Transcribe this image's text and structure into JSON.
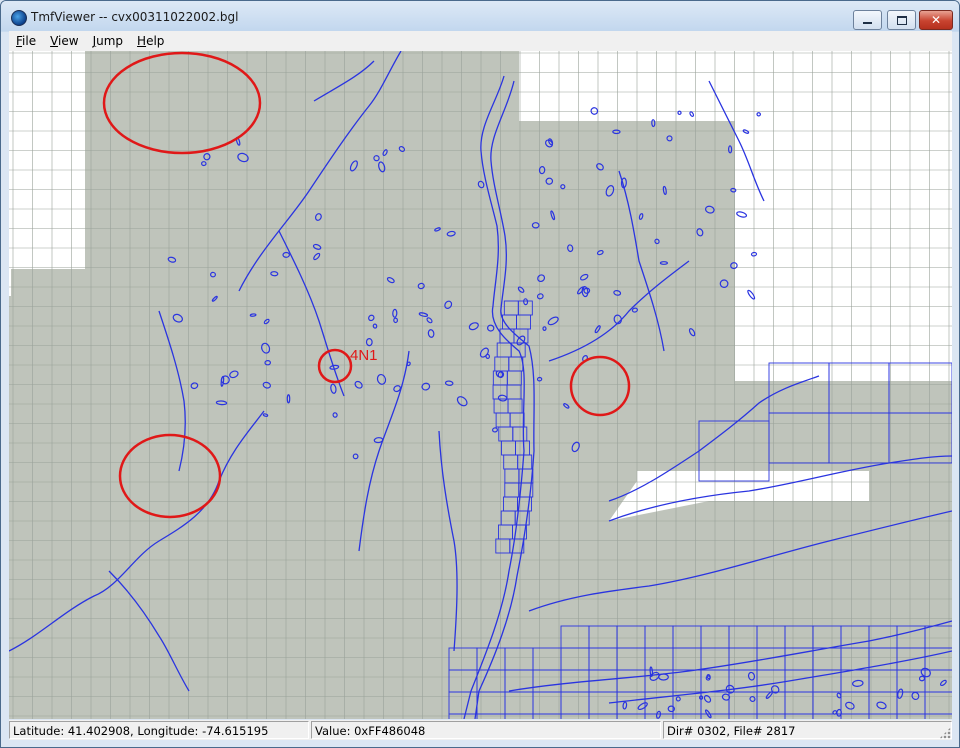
{
  "window": {
    "title": "TmfViewer -- cvx00311022002.bgl"
  },
  "menu": {
    "file": "F",
    "file_rest": "ile",
    "view": "V",
    "view_rest": "iew",
    "jump": "J",
    "jump_rest": "ump",
    "help": "H",
    "help_rest": "elp"
  },
  "map": {
    "marker_label": "4N1",
    "colors": {
      "terrain": "#bfc4bb",
      "grid": "#9aa29a",
      "water": "#2a34e0",
      "marker": "#e01818",
      "empty": "#ffffff"
    }
  },
  "status": {
    "coords": "Latitude: 41.402908, Longitude: -74.615195",
    "value": "Value: 0xFF486048",
    "dirfile": "Dir# 0302, File# 2817"
  }
}
